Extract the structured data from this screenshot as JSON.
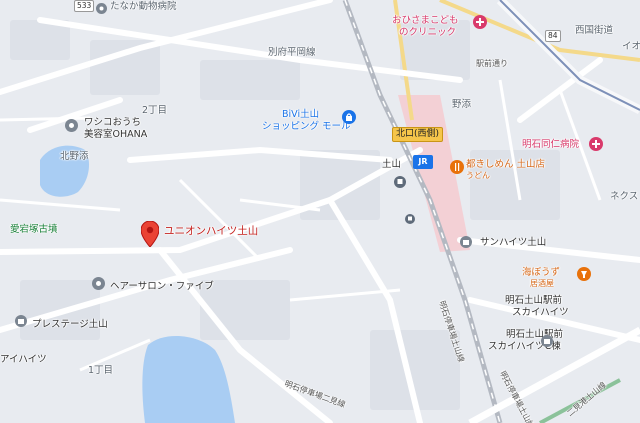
{
  "map": {
    "colors": {
      "background": "#e8ebf0",
      "block": "#dde1e8",
      "road": "#ffffff",
      "major_road": "#f7f8fa",
      "water": "#a9cdf3",
      "rail": "#b4b9c2",
      "station_area": "#f7c7cc",
      "accent_yellow": "#f6c54a",
      "pin_red": "#ea4335",
      "poi_orange": "#e8710a",
      "poi_pink": "#d93a6b",
      "poi_blue": "#1a73e8"
    },
    "labels": {
      "tanaka_vet": "たなか動物病院",
      "beppu_road": "別府平岡線",
      "ohisama_clinic_1": "おひさまこども",
      "ohisama_clinic_2": "のクリニック",
      "nishikokaido": "西国街道",
      "io": "イオ",
      "ekimae_dori": "駅前通り",
      "nozoe": "野添",
      "nichome": "2丁目",
      "bivi_1": "BiVi土山",
      "bivi_2": "ショッピング モール",
      "kitaguchi": "北口(西側)",
      "waco_1": "ワシコおうち",
      "waco_2": "美容室OHANA",
      "kitanozoe": "北野添",
      "akashi_hospital": "明石同仁病院",
      "tsuchiyama": "土山",
      "miyako_1": "都きしめん 土山店",
      "miyako_2": "うどん",
      "nexus": "ネクス",
      "atagozuka": "愛宕塚古墳",
      "union_heights": "ユニオンハイツ土山",
      "sun_heights": "サンハイツ土山",
      "hair_salon": "ヘアーサロン・ファイブ",
      "umihozu_1": "海ぼうず",
      "umihozu_2": "居酒屋",
      "sky_heights_1": "明石土山駅前",
      "sky_heights_2": "スカイハイツ",
      "prestige": "プレステージ土山",
      "sky_c_1": "明石土山駅前",
      "sky_c_2": "スカイハイツC棟",
      "aihaitsu": "アイハイツ",
      "itchome": "1丁目",
      "route_akashi_a": "明石停車場土山線",
      "route_akashi_b": "明石停車場土山線",
      "route_futami": "二見港土山線",
      "route_ninomiya": "明石停車場二見線",
      "route_533": "533",
      "route_84": "84",
      "jr_logo": "JR"
    }
  }
}
